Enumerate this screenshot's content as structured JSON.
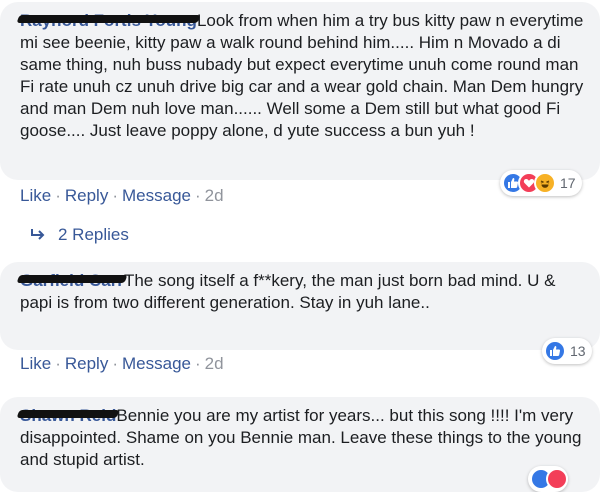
{
  "comments": [
    {
      "author": "Raynord Fortis Young",
      "text": "Look from when him a try bus kitty paw n everytime mi see beenie, kitty paw a walk round behind him..... Him n Movado a di same thing, nuh buss nubady but expect everytime unuh come round man Fi rate unuh cz unuh drive big car and a wear gold chain. Man Dem hungry and man Dem nuh love man...... Well some a Dem still but what good Fi goose.... Just leave poppy alone, d yute success a bun yuh !",
      "actions": {
        "like": "Like",
        "reply": "Reply",
        "message": "Message",
        "time": "2d"
      },
      "reactions": {
        "icons": [
          "like-icon",
          "love-icon",
          "haha-icon"
        ],
        "count": "17"
      }
    },
    {
      "author": "Garfield Carr",
      "text": "The song itself a f**kery, the man just born bad mind. U & papi is from two different generation. Stay in yuh lane..",
      "actions": {
        "like": "Like",
        "reply": "Reply",
        "message": "Message",
        "time": "2d"
      },
      "reactions": {
        "icons": [
          "like-icon"
        ],
        "count": "13"
      }
    },
    {
      "author": "Shawn Reid",
      "text": "Bennie you are my artist for years... but this song !!!! I'm very disappointed. Shame on you Bennie man. Leave these things to the young and stupid artist.",
      "reactions": {
        "icons": [
          "like-icon",
          "love-icon"
        ]
      }
    }
  ],
  "replies_link": "2 Replies",
  "separator": "·",
  "colors": {
    "link": "#385898",
    "bubble": "#f2f3f5",
    "like": "#3578e5",
    "love": "#f33e58",
    "haha": "#f7b125"
  }
}
